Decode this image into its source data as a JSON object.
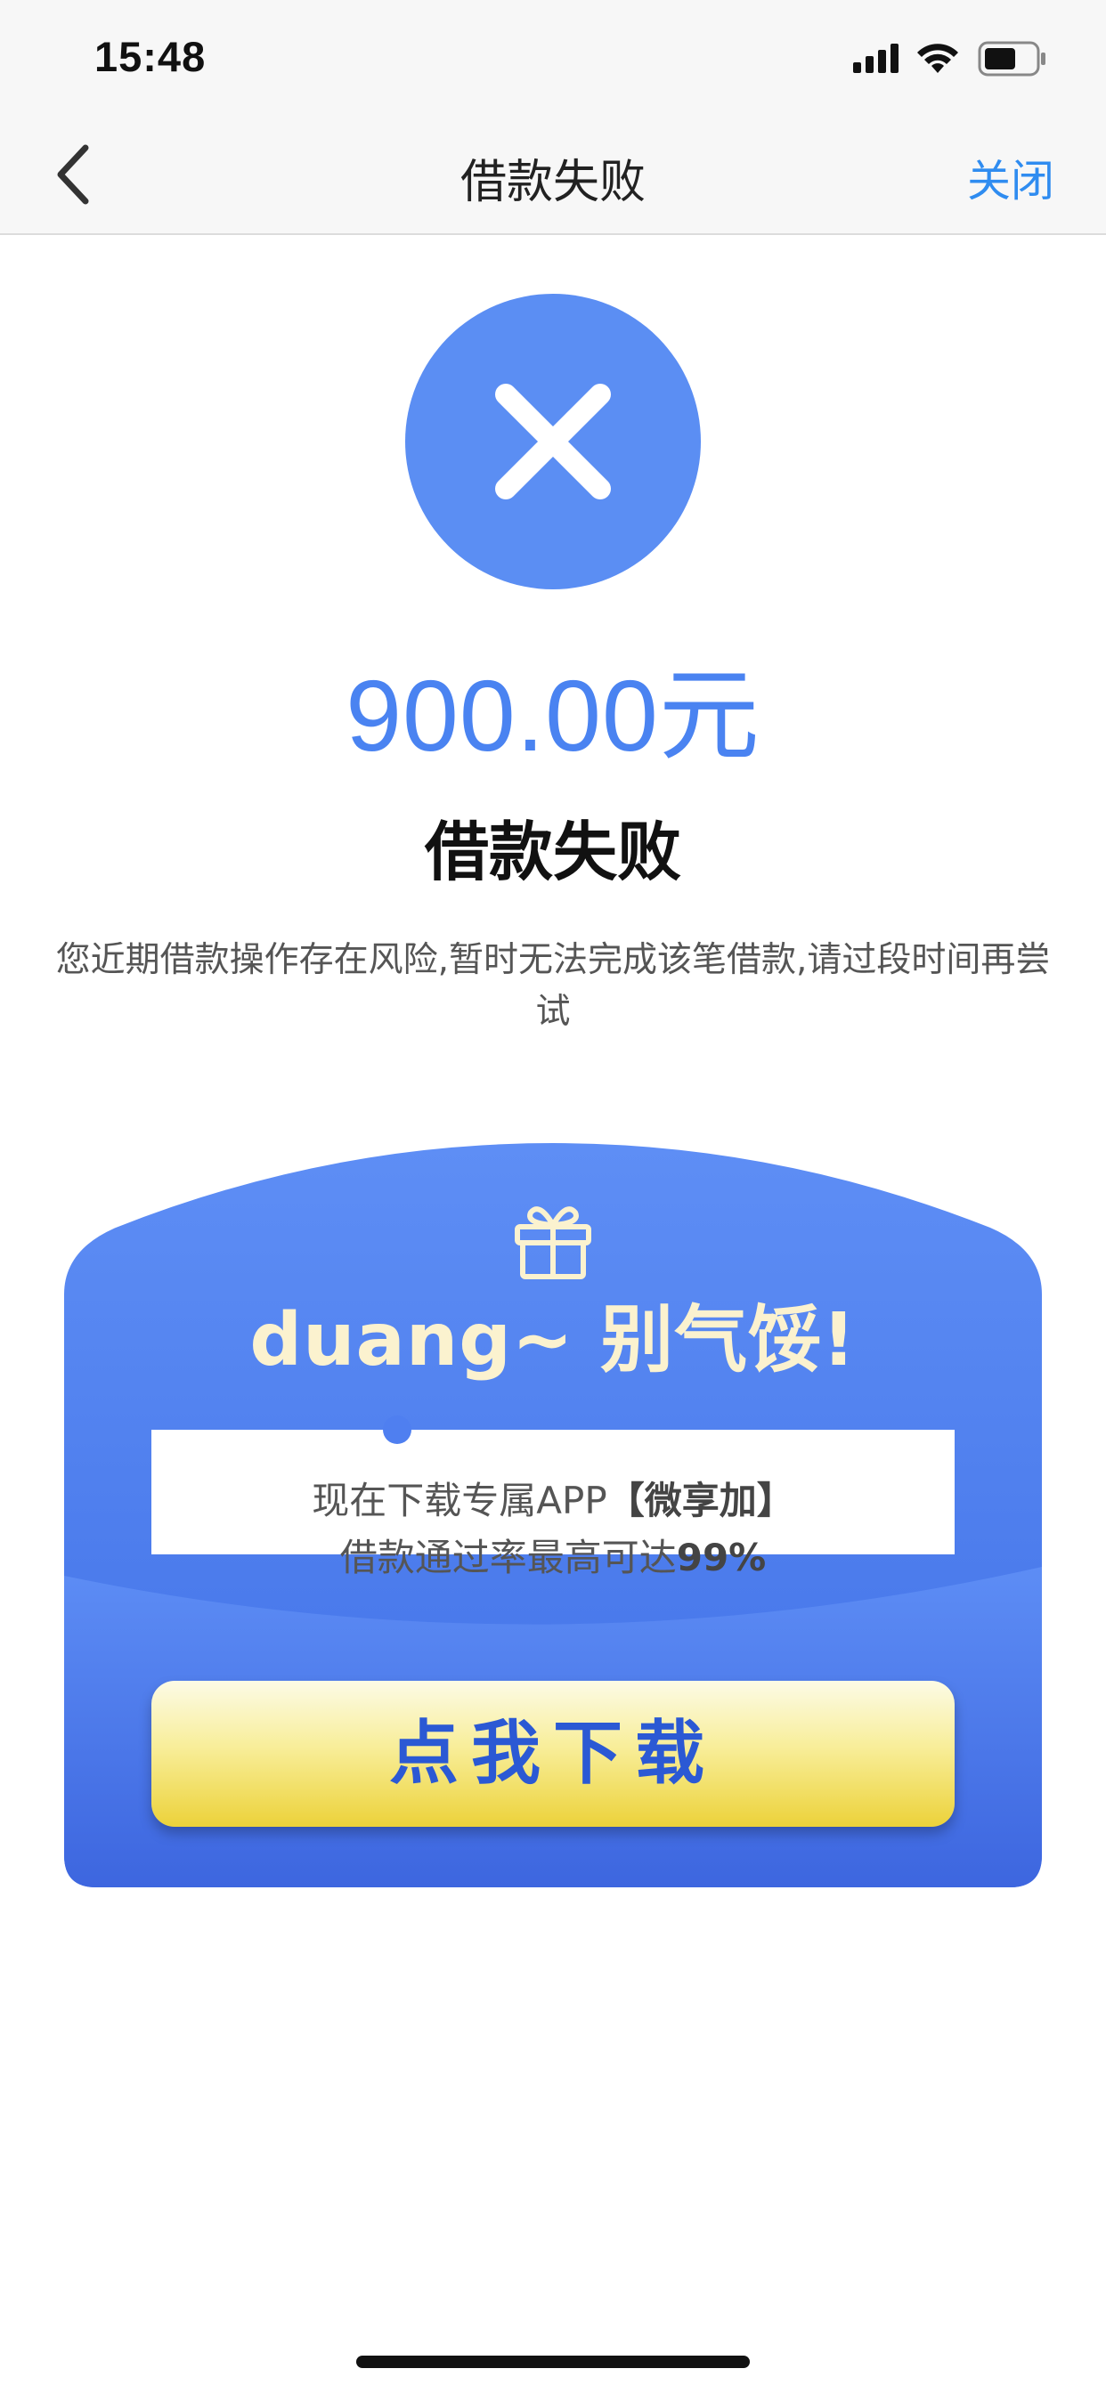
{
  "status_bar": {
    "time": "15:48",
    "icons": [
      "signal-icon",
      "wifi-icon",
      "battery-icon"
    ]
  },
  "nav": {
    "title": "借款失败",
    "close_label": "关闭",
    "back_icon": "chevron-left-icon"
  },
  "result": {
    "icon": "close-x-icon",
    "amount": "900.00元",
    "title": "借款失败",
    "description": "您近期借款操作存在风险,暂时无法完成该笔借款,请过段时间再尝试"
  },
  "promo": {
    "icon": "gift-icon",
    "title": "duang~ 别气馁!",
    "line1_prefix": "现在下载专属APP",
    "line1_highlight": "【微享加】",
    "line2_prefix": "借款通过率最高可达",
    "line2_highlight": "99%",
    "button_label": "点我下载"
  },
  "colors": {
    "accent": "#4a83f1",
    "link": "#2f8cf0",
    "card_blue": "#4f7ff0",
    "button_yellow": "#ecd23a",
    "button_text": "#2b59d4"
  }
}
